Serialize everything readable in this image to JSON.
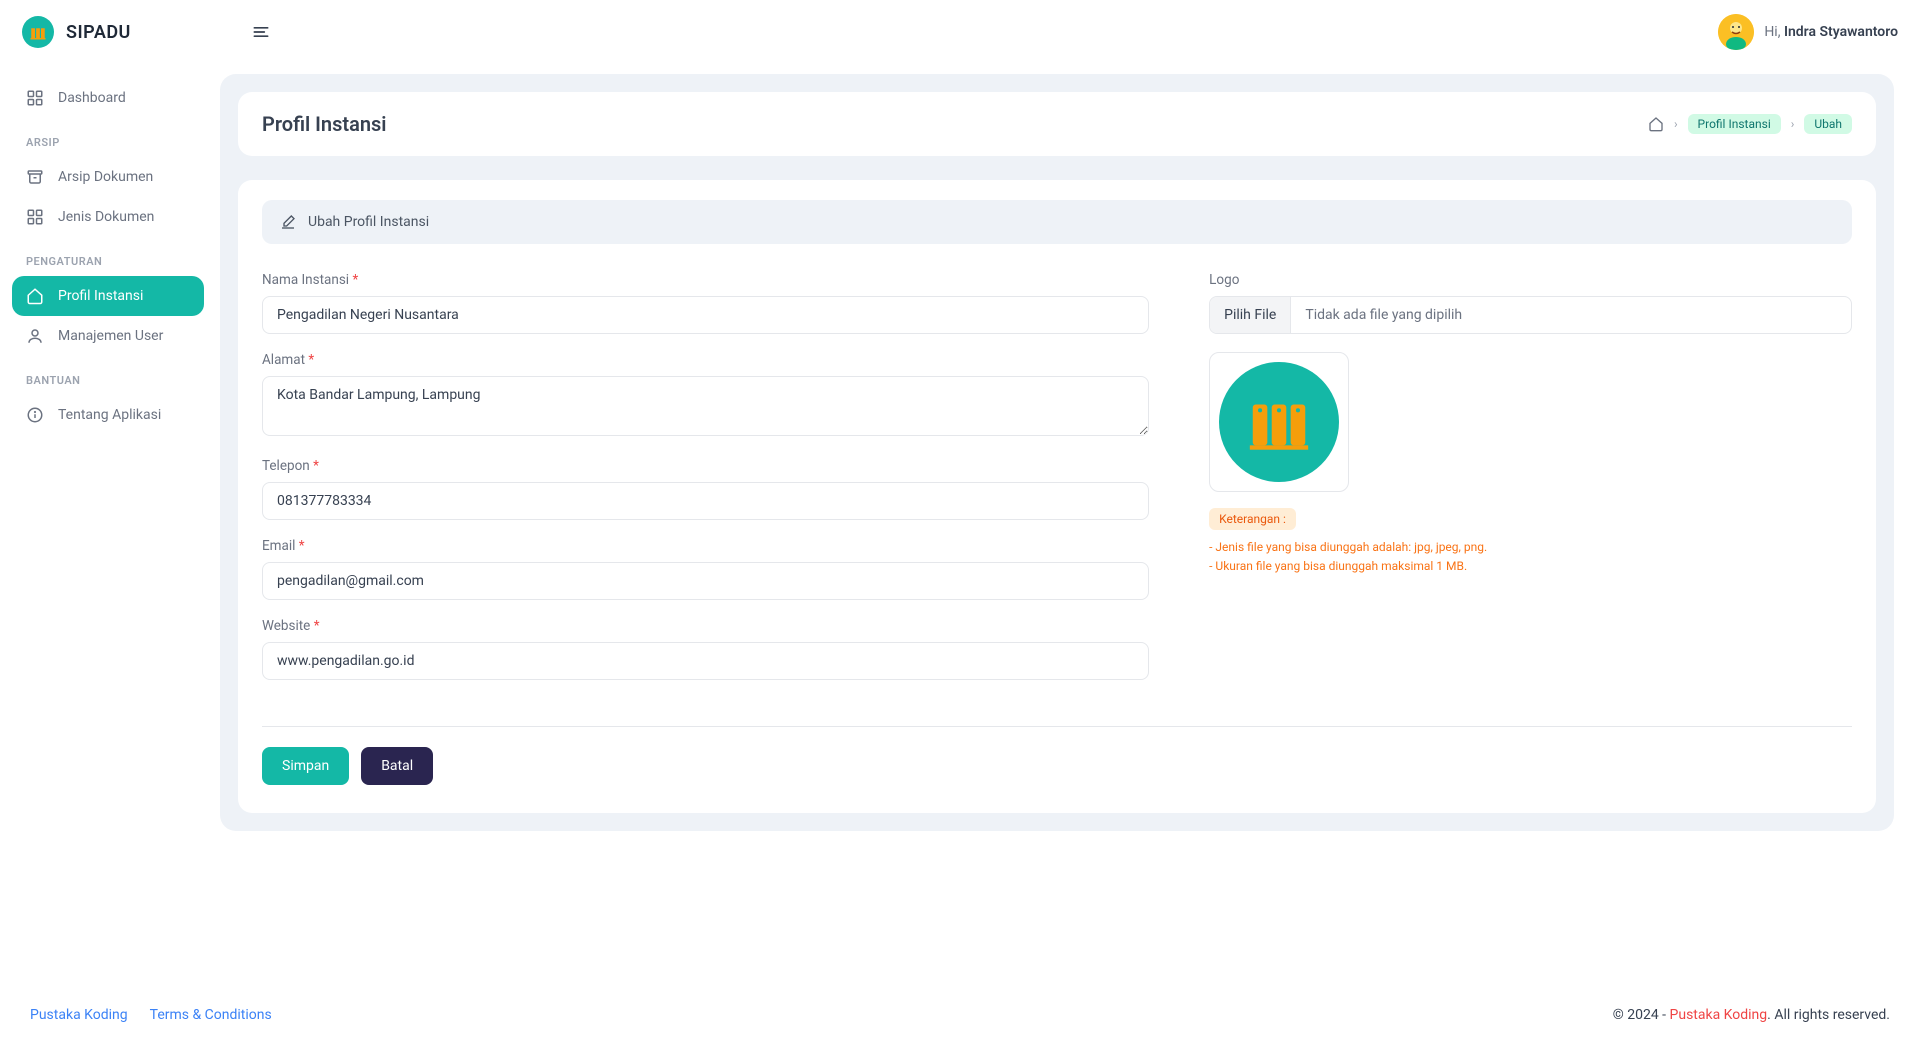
{
  "brand": {
    "name": "SIPADU"
  },
  "user": {
    "greeting": "Hi,",
    "name": "Indra Styawantoro"
  },
  "sidebar": {
    "items": [
      {
        "label": "Dashboard"
      }
    ],
    "sections": [
      {
        "title": "ARSIP",
        "items": [
          {
            "label": "Arsip Dokumen"
          },
          {
            "label": "Jenis Dokumen"
          }
        ]
      },
      {
        "title": "PENGATURAN",
        "items": [
          {
            "label": "Profil Instansi"
          },
          {
            "label": "Manajemen User"
          }
        ]
      },
      {
        "title": "BANTUAN",
        "items": [
          {
            "label": "Tentang Aplikasi"
          }
        ]
      }
    ]
  },
  "page": {
    "title": "Profil Instansi",
    "breadcrumb": {
      "a": "Profil Instansi",
      "b": "Ubah"
    },
    "panel_title": "Ubah Profil Instansi"
  },
  "form": {
    "nama_label": "Nama Instansi",
    "nama_value": "Pengadilan Negeri Nusantara",
    "alamat_label": "Alamat",
    "alamat_value": "Kota Bandar Lampung, Lampung",
    "telepon_label": "Telepon",
    "telepon_value": "081377783334",
    "email_label": "Email",
    "email_value": "pengadilan@gmail.com",
    "website_label": "Website",
    "website_value": "www.pengadilan.go.id",
    "logo_label": "Logo",
    "file_button": "Pilih File",
    "file_text": "Tidak ada file yang dipilih",
    "keterangan_label": "Keterangan :",
    "hint1": "- Jenis file yang bisa diunggah adalah: jpg, jpeg, png.",
    "hint2": "- Ukuran file yang bisa diunggah maksimal 1 MB.",
    "simpan": "Simpan",
    "batal": "Batal"
  },
  "footer": {
    "link1": "Pustaka Koding",
    "link2": "Terms & Conditions",
    "copyright_prefix": "© 2024 - ",
    "copyright_brand": "Pustaka Koding",
    "copyright_suffix": ". All rights reserved."
  }
}
